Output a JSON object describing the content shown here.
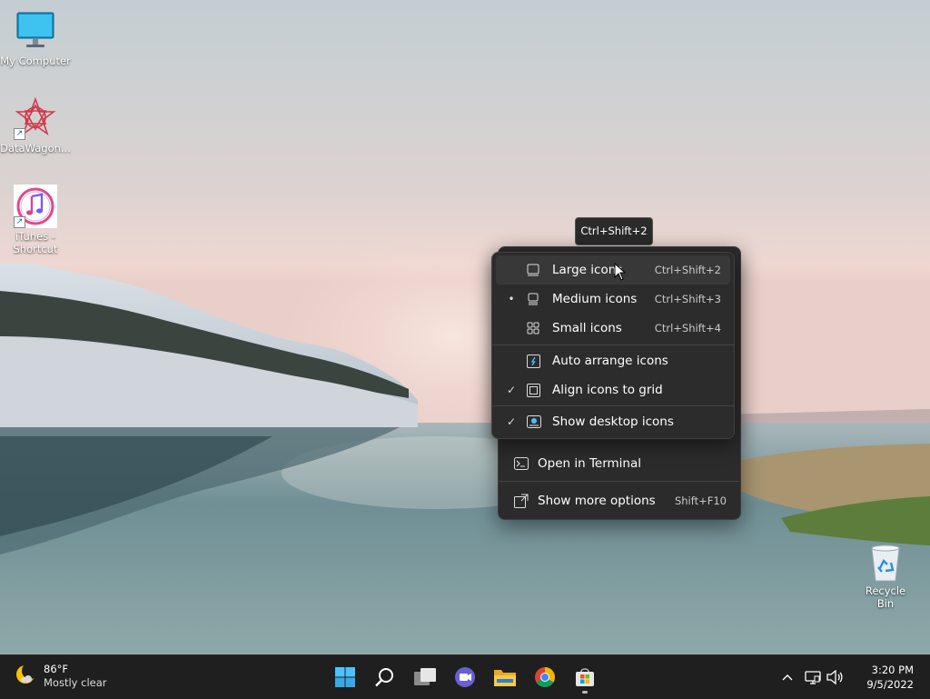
{
  "desktop": {
    "icons": [
      {
        "label": "My Computer"
      },
      {
        "label": "DataWagon..."
      },
      {
        "label": "iTunes - Shortcut"
      }
    ],
    "recycle_bin": "Recycle Bin"
  },
  "tooltip": "Ctrl+Shift+2",
  "view_submenu": {
    "items": [
      {
        "label": "Large icons",
        "accel": "Ctrl+Shift+2",
        "mark": "",
        "icon": "large-icons-icon"
      },
      {
        "label": "Medium icons",
        "accel": "Ctrl+Shift+3",
        "mark": "•",
        "icon": "medium-icons-icon"
      },
      {
        "label": "Small icons",
        "accel": "Ctrl+Shift+4",
        "mark": "",
        "icon": "small-icons-icon"
      },
      {
        "label": "Auto arrange icons",
        "accel": "",
        "mark": "",
        "icon": "auto-arrange-icon"
      },
      {
        "label": "Align icons to grid",
        "accel": "",
        "mark": "✓",
        "icon": "align-grid-icon"
      },
      {
        "label": "Show desktop icons",
        "accel": "",
        "mark": "✓",
        "icon": "show-desktop-icon"
      }
    ]
  },
  "context_menu": {
    "items": [
      {
        "label": "Open in Terminal",
        "accel": "",
        "icon": "terminal-icon"
      },
      {
        "label": "Show more options",
        "accel": "Shift+F10",
        "icon": "more-options-icon"
      }
    ]
  },
  "taskbar": {
    "weather": {
      "temp": "86°F",
      "condition": "Mostly clear"
    },
    "apps": [
      "start",
      "search",
      "task-view",
      "chat",
      "file-explorer",
      "chrome",
      "microsoft-store"
    ],
    "clock": {
      "time": "3:20 PM",
      "date": "9/5/2022"
    }
  },
  "colors": {
    "menu_bg": "#2c2c2c",
    "taskbar_bg": "#1f1f1f",
    "accent": "#4cc2ff"
  }
}
